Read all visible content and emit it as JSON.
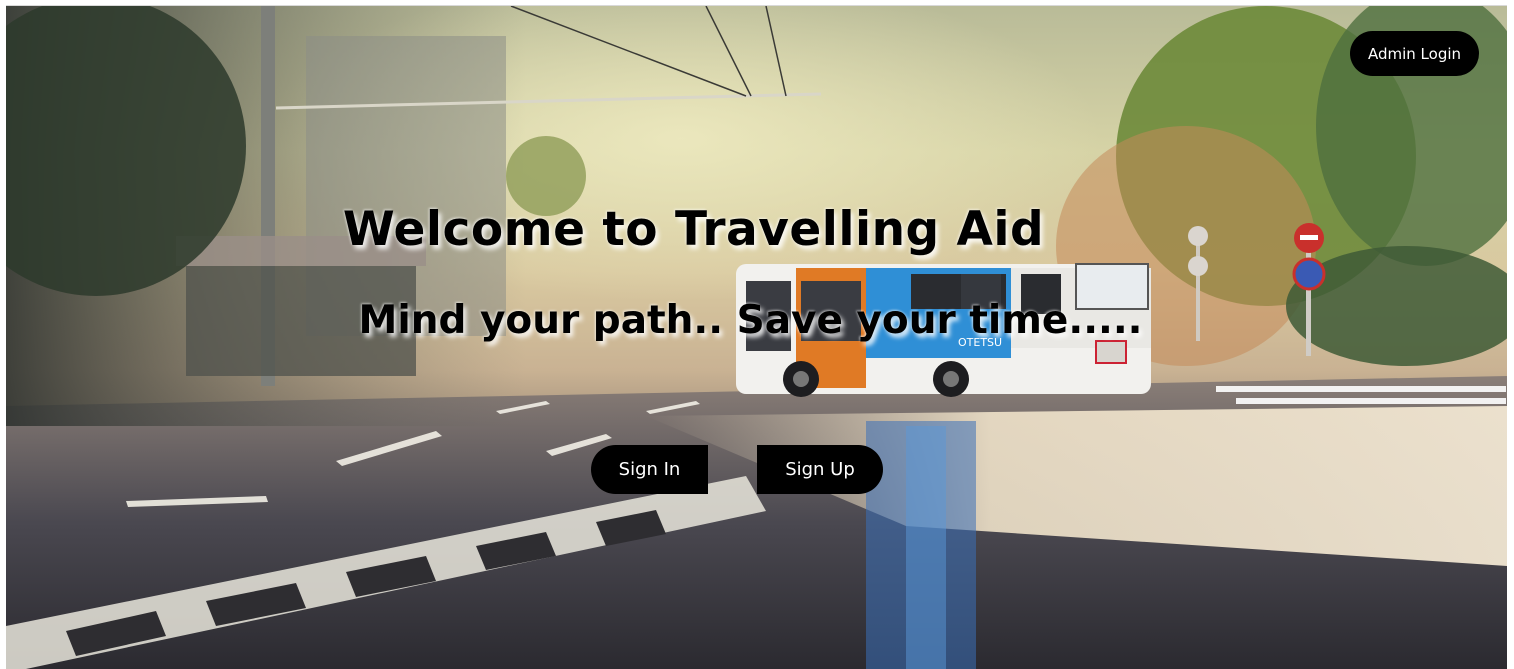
{
  "header": {
    "admin_login_label": "Admin Login"
  },
  "hero": {
    "title": "Welcome to Travelling Aid",
    "subtitle": "Mind your path.. Save your time....."
  },
  "actions": {
    "sign_in_label": "Sign In",
    "sign_up_label": "Sign Up"
  },
  "bus": {
    "side_text": "OTETSU"
  },
  "colors": {
    "button_bg": "#000000",
    "button_text": "#ffffff",
    "title_text": "#000000",
    "title_glow": "#ffffff"
  }
}
